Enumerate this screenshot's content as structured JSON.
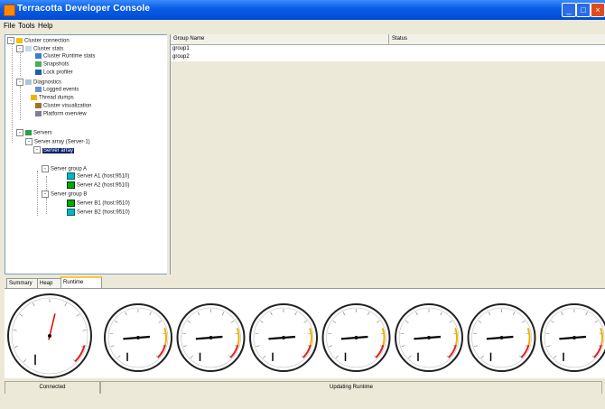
{
  "window": {
    "title": "Terracotta Developer Console"
  },
  "menu": {
    "items": [
      "File",
      "Tools",
      "Help"
    ]
  },
  "tree": {
    "root": "Cluster connection",
    "nodes": [
      {
        "label": "Cluster stats",
        "icon": "folder-icon"
      },
      {
        "label": "Cluster Runtime stats",
        "icon": "stats-icon"
      },
      {
        "label": "Snapshots",
        "icon": "snapshot-icon"
      },
      {
        "label": "Lock profiler",
        "icon": "lock-icon"
      },
      {
        "label": "Diagnostics",
        "icon": "folder-icon"
      },
      {
        "label": "Logged events",
        "icon": "events-icon"
      },
      {
        "label": "Thread dumps",
        "icon": "thread-icon"
      },
      {
        "label": "Cluster visualization",
        "icon": "cluster-icon"
      },
      {
        "label": "Platform overview",
        "icon": "platform-icon"
      },
      {
        "label": "Servers",
        "icon": "server-icon"
      },
      {
        "label": "Server array (Server-1)",
        "icon": "array-icon"
      },
      {
        "label": "Server array",
        "icon": "array-icon"
      },
      {
        "label": "Server group A",
        "icon": "group-icon"
      },
      {
        "label": "Server A1 (host:9510)",
        "icon": "server-green-icon"
      },
      {
        "label": "Server A2 (host:9510)",
        "icon": "server-green-icon"
      },
      {
        "label": "Server group B",
        "icon": "group-icon"
      },
      {
        "label": "Server B1 (host:9510)",
        "icon": "server-green-icon"
      },
      {
        "label": "Server B2 (host:9510)",
        "icon": "server-cyan-icon"
      }
    ]
  },
  "table": {
    "columns": [
      "Group Name",
      "Status"
    ],
    "rows": [
      {
        "name": "group1",
        "status": ""
      },
      {
        "name": "group2",
        "status": ""
      }
    ]
  },
  "tabs": [
    "Summary",
    "Heap",
    "Runtime"
  ],
  "gauges": {
    "count": 8,
    "first_level": 0.55,
    "other_level": 0.15
  },
  "statusbar": {
    "left": "Connected",
    "center": "Updating Runtime"
  },
  "colors": {
    "titlebar": "#0a5fe6",
    "needle_primary": "#e00000",
    "needle_other": "#000000"
  }
}
